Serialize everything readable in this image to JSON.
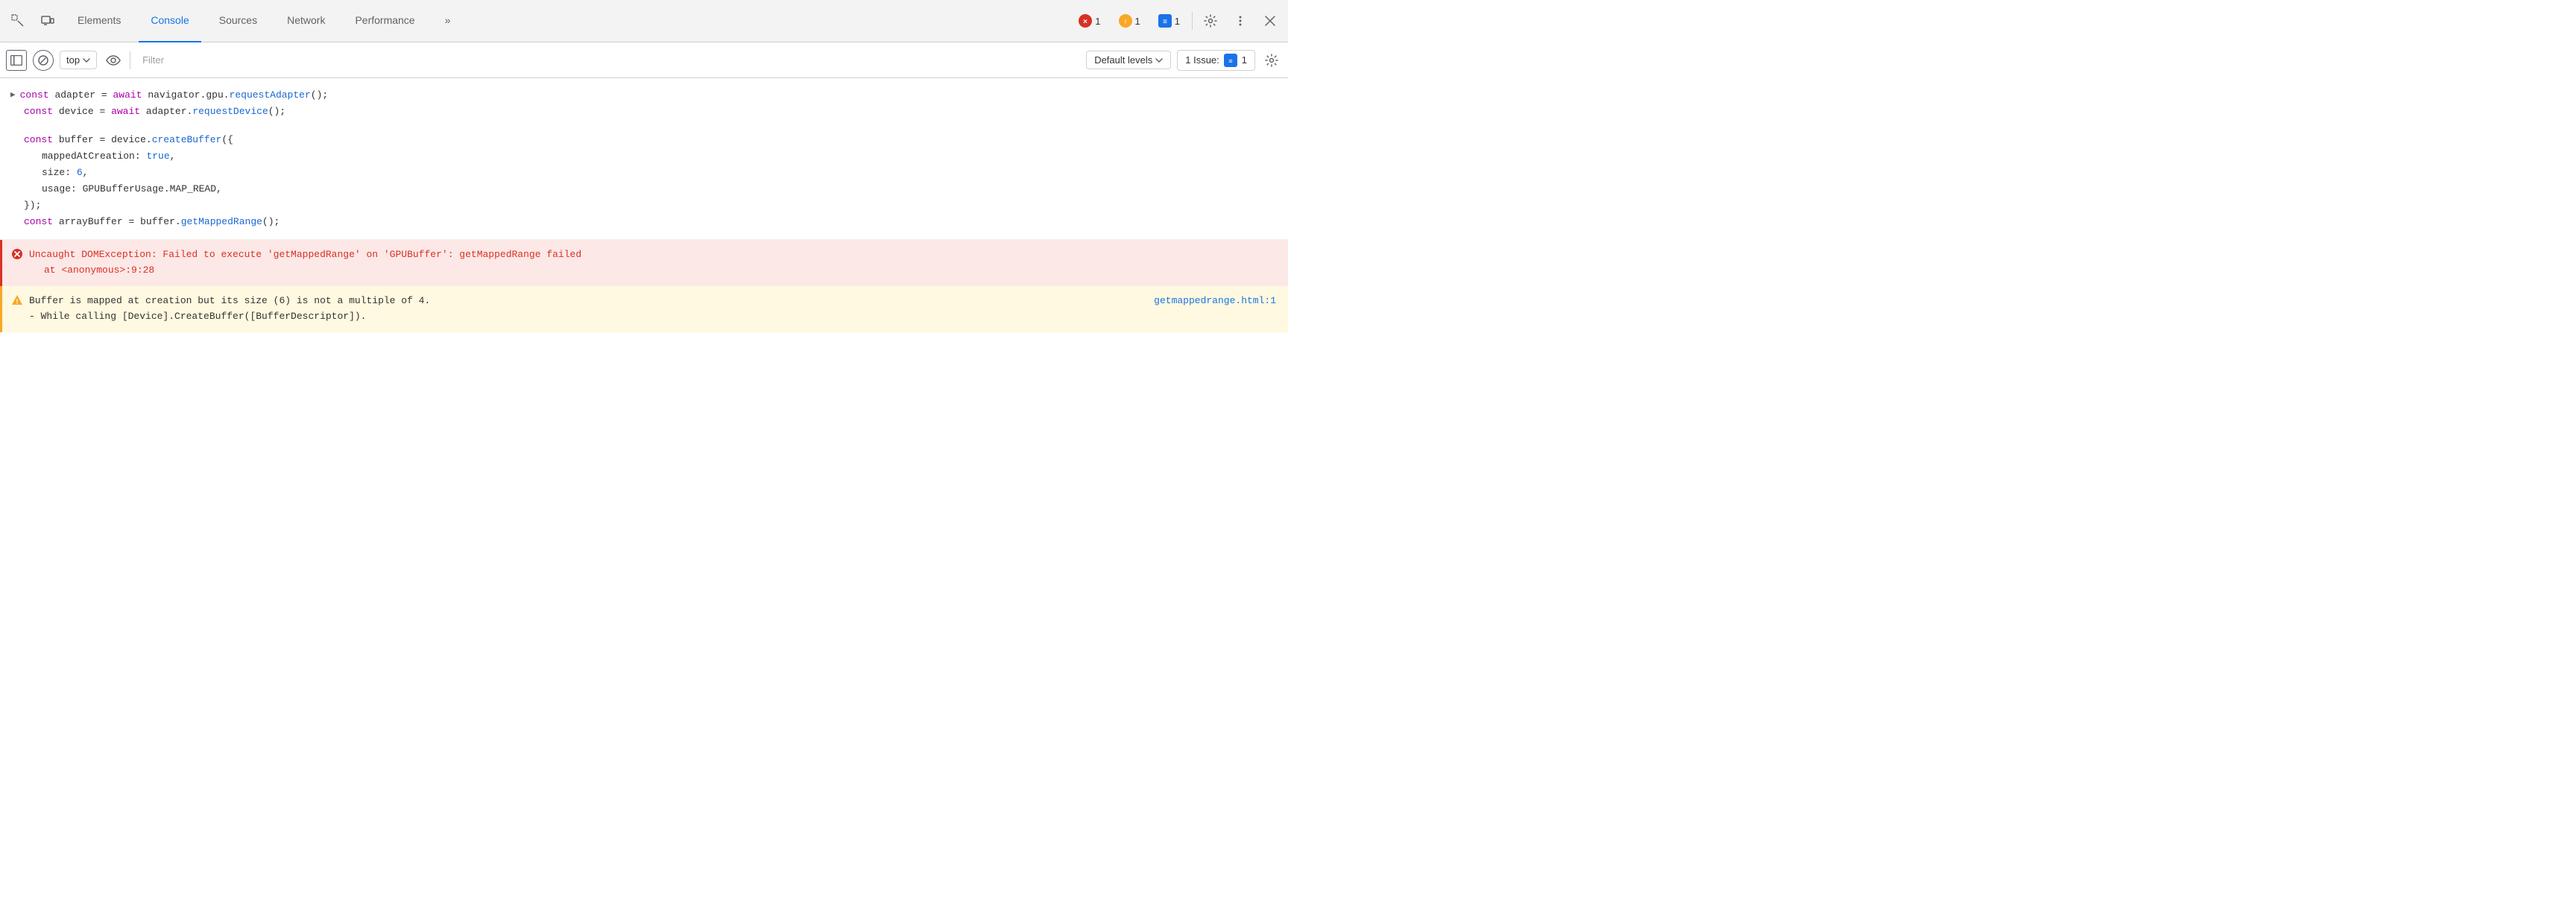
{
  "tabBar": {
    "tabs": [
      {
        "id": "elements",
        "label": "Elements",
        "active": false
      },
      {
        "id": "console",
        "label": "Console",
        "active": true
      },
      {
        "id": "sources",
        "label": "Sources",
        "active": false
      },
      {
        "id": "network",
        "label": "Network",
        "active": false
      },
      {
        "id": "performance",
        "label": "Performance",
        "active": false
      },
      {
        "id": "more",
        "label": "»",
        "active": false
      }
    ],
    "errorCount": "1",
    "warnCount": "1",
    "infoCount": "1"
  },
  "toolbar": {
    "contextLabel": "top",
    "filterPlaceholder": "Filter",
    "levelsLabel": "Default levels",
    "issuesLabel": "1 Issue:",
    "issuesCount": "1"
  },
  "console": {
    "lines": [
      {
        "type": "code",
        "hasArrow": true,
        "content": "const adapter = await navigator.gpu.requestAdapter();"
      },
      {
        "type": "code-indent",
        "content": "const device = await adapter.requestDevice();"
      },
      {
        "type": "blank"
      },
      {
        "type": "code-indent",
        "content": "const buffer = device.createBuffer({"
      },
      {
        "type": "code-indent2",
        "content": "mappedAtCreation: true,"
      },
      {
        "type": "code-indent2",
        "content": "size: 6,"
      },
      {
        "type": "code-indent2",
        "content": "usage: GPUBufferUsage.MAP_READ,"
      },
      {
        "type": "code-indent",
        "content": "});"
      },
      {
        "type": "code-indent",
        "content": "const arrayBuffer = buffer.getMappedRange();"
      }
    ],
    "errorMessage": "Uncaught DOMException: Failed to execute 'getMappedRange' on 'GPUBuffer': getMappedRange failed",
    "errorSubMessage": "    at <anonymous>:9:28",
    "warnMessage": "Buffer is mapped at creation but its size (6) is not a multiple of 4.",
    "warnSubMessage": "  - While calling [Device].CreateBuffer([BufferDescriptor]).",
    "warnLink": "getmappedrange.html:1"
  }
}
